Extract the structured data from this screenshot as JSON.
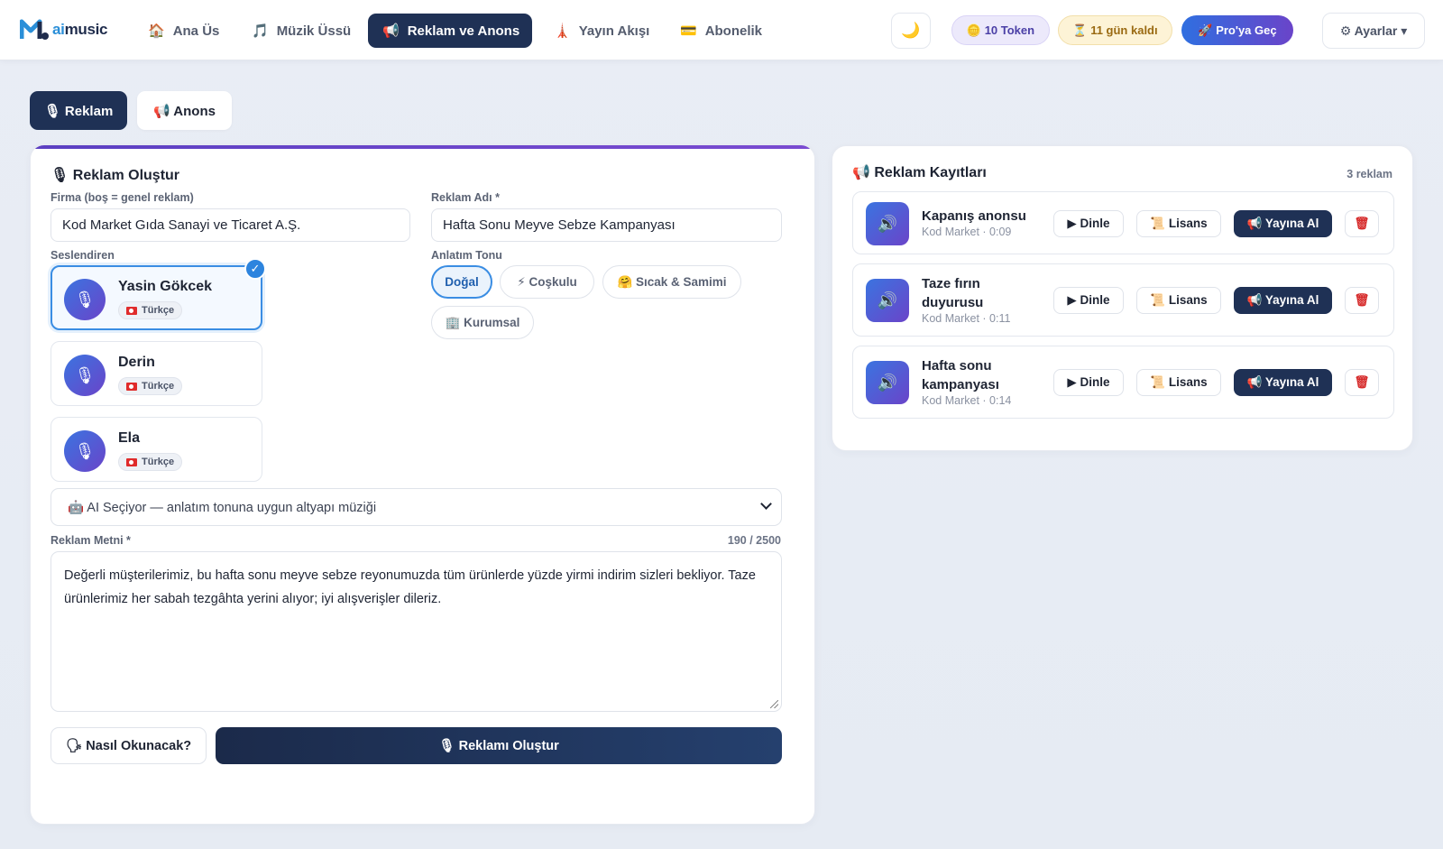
{
  "app": {
    "logo_ai": "ai",
    "logo_music": "music"
  },
  "nav": {
    "items": [
      {
        "icon": "home-icon",
        "glyph": "🏠",
        "label": "Ana Üs"
      },
      {
        "icon": "music-note-icon",
        "glyph": "🎵",
        "label": "Müzik Üssü"
      },
      {
        "icon": "megaphone-icon",
        "glyph": "📢",
        "label": "Reklam ve Anons",
        "active": true
      },
      {
        "icon": "tower-icon",
        "glyph": "🗼",
        "label": "Yayın Akışı"
      },
      {
        "icon": "credit-card-icon",
        "glyph": "💳",
        "label": "Abonelik"
      }
    ],
    "theme_glyph": "🌙",
    "token_label": "🪙 10 Token",
    "days_label": "⏳ 11 gün kaldı",
    "pro_label": "🚀 Pro'ya Geç",
    "settings_label": "⚙ Ayarlar ▾"
  },
  "tabs": {
    "reklam": "🎙 Reklam",
    "anons": "📢 Anons"
  },
  "create": {
    "title": "🎙 Reklam Oluştur",
    "firma_label": "Firma (boş = genel reklam)",
    "firma_value": "Kod Market Gıda Sanayi ve Ticaret A.Ş.",
    "ad_label": "Reklam Adı *",
    "ad_value": "Hafta Sonu Meyve Sebze Kampanyası",
    "voice_label": "Seslendiren",
    "voices": [
      {
        "name": "Yasin Gökcek",
        "lang": "Türkçe",
        "selected": true
      },
      {
        "name": "Derin",
        "lang": "Türkçe",
        "selected": false
      },
      {
        "name": "Ela",
        "lang": "Türkçe",
        "selected": false
      }
    ],
    "tone_label": "Anlatım Tonu",
    "tones": [
      {
        "label": "Doğal",
        "selected": true
      },
      {
        "label": "⚡ Coşkulu",
        "selected": false
      },
      {
        "label": "🤗 Sıcak & Samimi",
        "selected": false
      },
      {
        "label": "🏢 Kurumsal",
        "selected": false
      }
    ],
    "music_select": "🤖 AI Seçiyor — anlatım tonuna uygun altyapı müziği",
    "text_label": "Reklam Metni *",
    "char_count": "190 / 2500",
    "text_value": "Değerli müşterilerimiz, bu hafta sonu meyve sebze reyonumuzda tüm ürünlerde yüzde yirmi indirim sizleri bekliyor. Taze ürünlerimiz her sabah tezgâhta yerini alıyor; iyi alışverişler dileriz.",
    "how_button": "🗣 Nasıl Okunacak?",
    "create_button": "🎙 Reklamı Oluştur"
  },
  "records": {
    "title": "📢 Reklam Kayıtları",
    "count": "3 reklam",
    "play_label": "▶ Dinle",
    "license_label": "📜 Lisans",
    "publish_label": "📢 Yayına Al",
    "delete_glyph": "🗑",
    "items": [
      {
        "name": "Kapanış anonsu",
        "meta": "Kod Market · 0:09"
      },
      {
        "name": "Taze fırın duyurusu",
        "meta": "Kod Market · 0:11"
      },
      {
        "name": "Hafta sonu kampanyası",
        "meta": "Kod Market · 0:14"
      }
    ]
  },
  "colors": {
    "primary_dark": "#1f3155",
    "accent_blue": "#3a8de3",
    "accent_purple": "#6a44c9"
  }
}
